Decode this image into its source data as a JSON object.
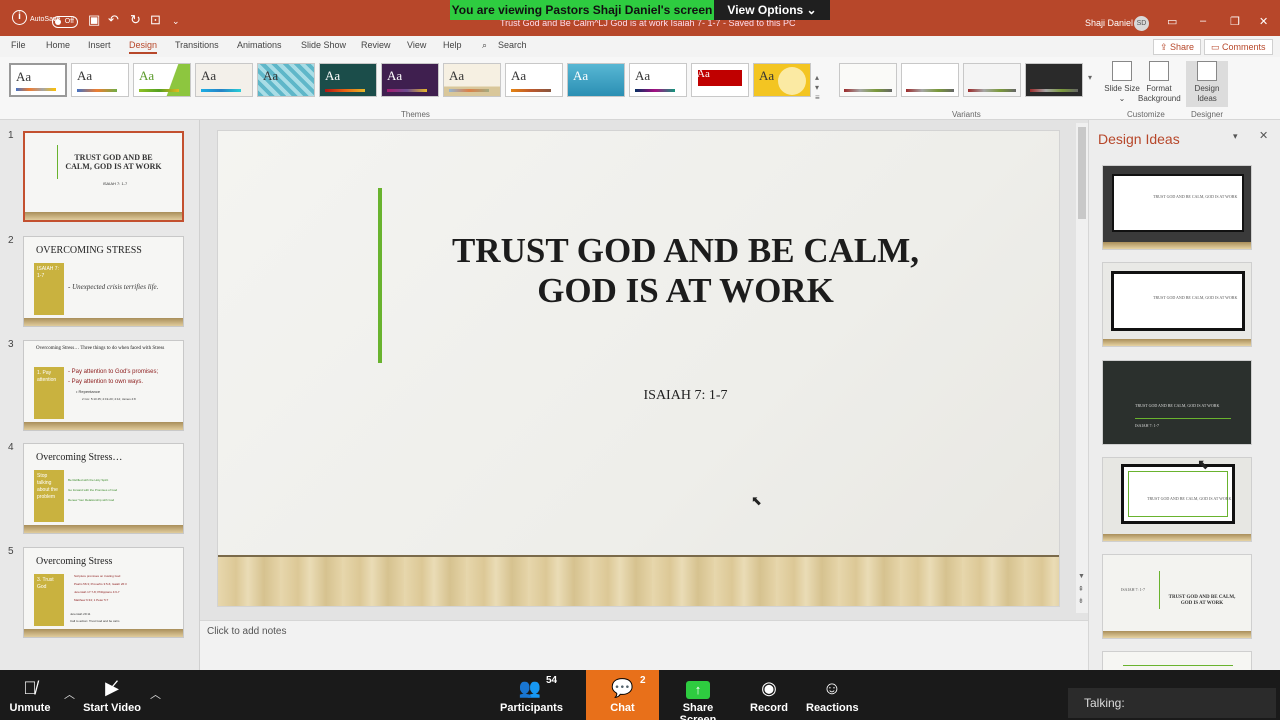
{
  "zoom": {
    "banner_message": "You are viewing Pastors Shaji Daniel's screen",
    "view_options": "View Options ⌄",
    "toolbar": {
      "unmute": "Unmute",
      "start_video": "Start Video",
      "participants": "Participants",
      "participants_count": "54",
      "chat": "Chat",
      "chat_count": "2",
      "share_screen": "Share Screen",
      "record": "Record",
      "reactions": "Reactions"
    },
    "talking": "Talking:"
  },
  "titlebar": {
    "autosave_label": "AutoSave",
    "autosave_state": "Off",
    "document_title": "Trust God and Be Calm^LJ God is at work Isaiah 7- 1-7  -  Saved to this PC",
    "user_name": "Shaji Daniel",
    "user_initials": "SD"
  },
  "ribbon": {
    "tabs": [
      "File",
      "Home",
      "Insert",
      "Design",
      "Transitions",
      "Animations",
      "Slide Show",
      "Review",
      "View",
      "Help"
    ],
    "search": "Search",
    "share": "Share",
    "comments": "Comments",
    "theme_glyph": "Aa",
    "groups": {
      "themes": "Themes",
      "variants": "Variants",
      "customize": "Customize",
      "designer": "Designer"
    },
    "buttons": {
      "slide_size": "Slide Size ⌄",
      "format_background": "Format Background",
      "design_ideas": "Design Ideas"
    },
    "colors": {
      "accent": "#b7472a",
      "banner_green": "#2ecc40",
      "slide_accent": "#69b32e"
    }
  },
  "slides": [
    {
      "num": "1",
      "title": "TRUST GOD AND BE CALM, GOD IS AT WORK",
      "sub": "ISAIAH 7: 1-7"
    },
    {
      "num": "2",
      "title": "OVERCOMING STRESS",
      "gold_text": "ISAIAH 7: 1-7",
      "lines": [
        "- Unexpected crisis terrifies life."
      ]
    },
    {
      "num": "3",
      "title": "Overcoming Stress… Three things to do when faced with Stress",
      "gold_text": "1. Pay attention",
      "lines": [
        "- Pay attention to God's promises;",
        "- Pay attention to own ways.",
        "• Repentance",
        "2 Cor. 5:10 45; 2:19-20; 4:12; James 4:8"
      ]
    },
    {
      "num": "4",
      "title": "Overcoming Stress…",
      "gold_text": "Stop talking about the problem",
      "lines": [
        "Be Refilled with the Holy Spirit",
        "Go forward with the Promises of God",
        "Renew Your Relationship with God"
      ]
    },
    {
      "num": "5",
      "title": "Overcoming Stress",
      "gold_text": "3. Trust God",
      "lines": [
        "Scripture promises on trusting God",
        "Psalm 56:3; Proverbs 3:5-6; Isaiah 26:3",
        "Jeremiah 17:7-8; Philippians 4:6-7",
        "Matthew 6:34; 1 Peter 5:7",
        "Jeremiah 29:11",
        "Call to action: Trust God and be calm"
      ]
    }
  ],
  "current_slide": {
    "title_line1": "TRUST GOD AND BE CALM,",
    "title_line2": "GOD IS AT WORK",
    "subtitle": "ISAIAH 7: 1-7"
  },
  "notes_placeholder": "Click to add notes",
  "design_ideas": {
    "title": "Design Ideas",
    "mini_title": "TRUST GOD AND BE CALM, GOD IS AT WORK",
    "mini_sub": "ISAIAH 7: 1-7"
  }
}
